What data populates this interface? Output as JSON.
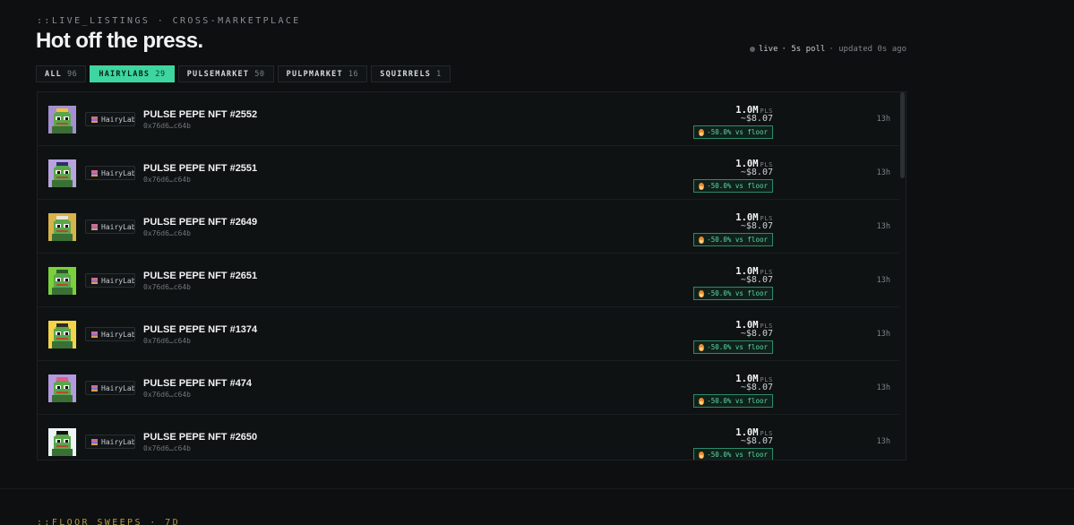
{
  "header": {
    "eyebrow": "::LIVE_LISTINGS · CROSS-MARKETPLACE",
    "title": "Hot off the press.",
    "status_live": "live",
    "status_poll": "· 5s poll",
    "status_updated": "· updated 0s ago"
  },
  "tabs": [
    {
      "label": "ALL",
      "count": "96"
    },
    {
      "label": "HAIRYLABS",
      "count": "29"
    },
    {
      "label": "PULSEMARKET",
      "count": "50"
    },
    {
      "label": "PULPMARKET",
      "count": "16"
    },
    {
      "label": "SQUIRRELS",
      "count": "1"
    }
  ],
  "active_tab": "HAIRYLABS",
  "colors": {
    "accent": "#3ed6a0",
    "floor_badge_text": "#5fd6a6",
    "section_2_eyebrow": "#b59a3d"
  },
  "listings": [
    {
      "name": "PULSE PEPE NFT #2552",
      "address": "0x76d6…c64b",
      "marketplace": "HairyLabs",
      "price": "1.0M",
      "unit": "PLS",
      "usd": "~$8.07",
      "floor_delta": "-50.0% vs floor",
      "age": "13h",
      "thumb_bg": "#a48fd1",
      "thumb_acc": "#f0c23a"
    },
    {
      "name": "PULSE PEPE NFT #2551",
      "address": "0x76d6…c64b",
      "marketplace": "HairyLabs",
      "price": "1.0M",
      "unit": "PLS",
      "usd": "~$8.07",
      "floor_delta": "-50.0% vs floor",
      "age": "13h",
      "thumb_bg": "#b8a3e0",
      "thumb_acc": "#2a2f6b"
    },
    {
      "name": "PULSE PEPE NFT #2649",
      "address": "0x76d6…c64b",
      "marketplace": "HairyLabs",
      "price": "1.0M",
      "unit": "PLS",
      "usd": "~$8.07",
      "floor_delta": "-50.0% vs floor",
      "age": "13h",
      "thumb_bg": "#d8b24a",
      "thumb_acc": "#e9e6d8"
    },
    {
      "name": "PULSE PEPE NFT #2651",
      "address": "0x76d6…c64b",
      "marketplace": "HairyLabs",
      "price": "1.0M",
      "unit": "PLS",
      "usd": "~$8.07",
      "floor_delta": "-50.0% vs floor",
      "age": "13h",
      "thumb_bg": "#7bd13c",
      "thumb_acc": "#2c5a2a"
    },
    {
      "name": "PULSE PEPE NFT #1374",
      "address": "0x76d6…c64b",
      "marketplace": "HairyLabs",
      "price": "1.0M",
      "unit": "PLS",
      "usd": "~$8.07",
      "floor_delta": "-50.0% vs floor",
      "age": "13h",
      "thumb_bg": "#f1d44a",
      "thumb_acc": "#2b2b2b"
    },
    {
      "name": "PULSE PEPE NFT #474",
      "address": "0x76d6…c64b",
      "marketplace": "HairyLabs",
      "price": "1.0M",
      "unit": "PLS",
      "usd": "~$8.07",
      "floor_delta": "-50.0% vs floor",
      "age": "13h",
      "thumb_bg": "#b39adf",
      "thumb_acc": "#e65b8a"
    },
    {
      "name": "PULSE PEPE NFT #2650",
      "address": "0x76d6…c64b",
      "marketplace": "HairyLabs",
      "price": "1.0M",
      "unit": "PLS",
      "usd": "~$8.07",
      "floor_delta": "-50.0% vs floor",
      "age": "13h",
      "thumb_bg": "#eef3f6",
      "thumb_acc": "#111111"
    }
  ],
  "next_section": {
    "eyebrow": "::FLOOR_SWEEPS · 7D"
  }
}
